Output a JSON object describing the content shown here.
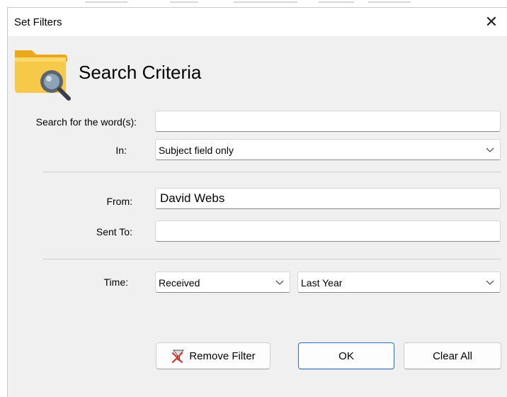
{
  "window": {
    "title": "Set Filters"
  },
  "header": {
    "title": "Search Criteria",
    "icon": "folder-search-icon"
  },
  "form": {
    "search_words": {
      "label": "Search for the word(s):",
      "value": ""
    },
    "in": {
      "label": "In:",
      "value": "Subject field only"
    },
    "from": {
      "label": "From:",
      "value": "David Webs"
    },
    "sent_to": {
      "label": "Sent To:",
      "value": ""
    },
    "time": {
      "label": "Time:",
      "type_value": "Received",
      "range_value": "Last Year"
    }
  },
  "buttons": {
    "remove_filter": "Remove Filter",
    "ok": "OK",
    "clear_all": "Clear All"
  },
  "colors": {
    "dialog_bg": "#f0f0f0",
    "folder_yellow": "#f7c948",
    "primary_border": "#2b6fc1"
  }
}
